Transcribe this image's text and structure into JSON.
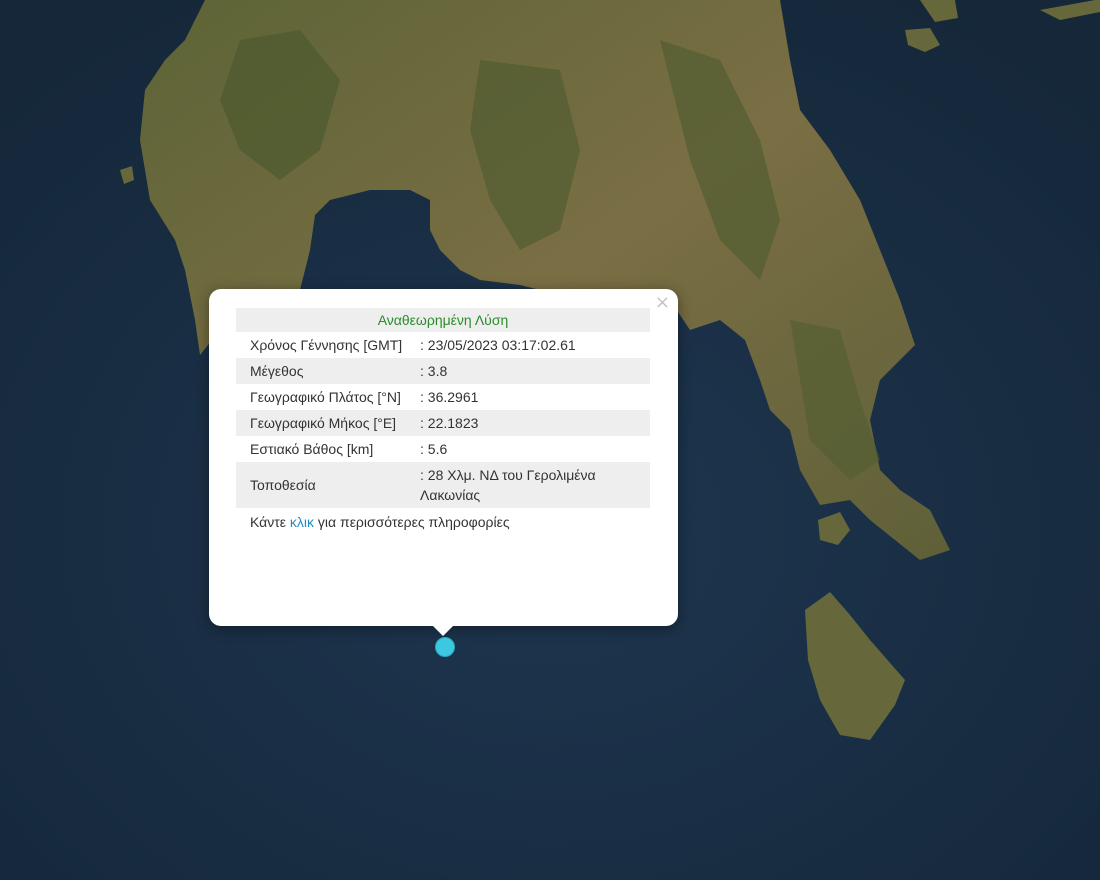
{
  "popup": {
    "title": "Αναθεωρημένη Λύση",
    "rows": [
      {
        "label": "Χρόνος Γέννησης [GMT]",
        "value": ": 23/05/2023 03:17:02.61"
      },
      {
        "label": "Μέγεθος",
        "value": ": 3.8"
      },
      {
        "label": "Γεωγραφικό Πλάτος [°N]",
        "value": ": 36.2961"
      },
      {
        "label": "Γεωγραφικό Μήκος [°E]",
        "value": ": 22.1823"
      },
      {
        "label": "Εστιακό Βάθος [km]",
        "value": ": 5.6"
      },
      {
        "label": "Τοποθεσία",
        "value": ": 28 Χλμ. ΝΔ του Γερολιμένα Λακωνίας"
      }
    ],
    "footer": {
      "prefix": "Κάντε ",
      "link": "κλικ",
      "suffix": " για περισσότερες πληροφορίες"
    },
    "close_symbol": "×"
  },
  "colors": {
    "sea": "#1a2f45",
    "land": "#6b6a3e",
    "marker": "#3cc8e0",
    "title_green": "#2b8c2b",
    "link_blue": "#1f8fc8"
  }
}
